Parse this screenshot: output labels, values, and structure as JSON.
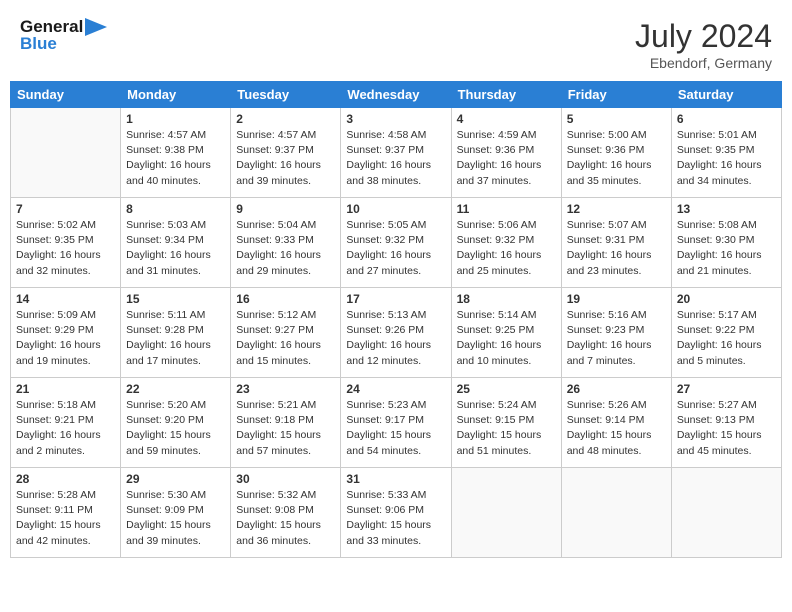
{
  "header": {
    "logo_line1": "General",
    "logo_line2": "Blue",
    "month_year": "July 2024",
    "location": "Ebendorf, Germany"
  },
  "days_of_week": [
    "Sunday",
    "Monday",
    "Tuesday",
    "Wednesday",
    "Thursday",
    "Friday",
    "Saturday"
  ],
  "weeks": [
    [
      {
        "day": "",
        "info": ""
      },
      {
        "day": "1",
        "info": "Sunrise: 4:57 AM\nSunset: 9:38 PM\nDaylight: 16 hours\nand 40 minutes."
      },
      {
        "day": "2",
        "info": "Sunrise: 4:57 AM\nSunset: 9:37 PM\nDaylight: 16 hours\nand 39 minutes."
      },
      {
        "day": "3",
        "info": "Sunrise: 4:58 AM\nSunset: 9:37 PM\nDaylight: 16 hours\nand 38 minutes."
      },
      {
        "day": "4",
        "info": "Sunrise: 4:59 AM\nSunset: 9:36 PM\nDaylight: 16 hours\nand 37 minutes."
      },
      {
        "day": "5",
        "info": "Sunrise: 5:00 AM\nSunset: 9:36 PM\nDaylight: 16 hours\nand 35 minutes."
      },
      {
        "day": "6",
        "info": "Sunrise: 5:01 AM\nSunset: 9:35 PM\nDaylight: 16 hours\nand 34 minutes."
      }
    ],
    [
      {
        "day": "7",
        "info": "Sunrise: 5:02 AM\nSunset: 9:35 PM\nDaylight: 16 hours\nand 32 minutes."
      },
      {
        "day": "8",
        "info": "Sunrise: 5:03 AM\nSunset: 9:34 PM\nDaylight: 16 hours\nand 31 minutes."
      },
      {
        "day": "9",
        "info": "Sunrise: 5:04 AM\nSunset: 9:33 PM\nDaylight: 16 hours\nand 29 minutes."
      },
      {
        "day": "10",
        "info": "Sunrise: 5:05 AM\nSunset: 9:32 PM\nDaylight: 16 hours\nand 27 minutes."
      },
      {
        "day": "11",
        "info": "Sunrise: 5:06 AM\nSunset: 9:32 PM\nDaylight: 16 hours\nand 25 minutes."
      },
      {
        "day": "12",
        "info": "Sunrise: 5:07 AM\nSunset: 9:31 PM\nDaylight: 16 hours\nand 23 minutes."
      },
      {
        "day": "13",
        "info": "Sunrise: 5:08 AM\nSunset: 9:30 PM\nDaylight: 16 hours\nand 21 minutes."
      }
    ],
    [
      {
        "day": "14",
        "info": "Sunrise: 5:09 AM\nSunset: 9:29 PM\nDaylight: 16 hours\nand 19 minutes."
      },
      {
        "day": "15",
        "info": "Sunrise: 5:11 AM\nSunset: 9:28 PM\nDaylight: 16 hours\nand 17 minutes."
      },
      {
        "day": "16",
        "info": "Sunrise: 5:12 AM\nSunset: 9:27 PM\nDaylight: 16 hours\nand 15 minutes."
      },
      {
        "day": "17",
        "info": "Sunrise: 5:13 AM\nSunset: 9:26 PM\nDaylight: 16 hours\nand 12 minutes."
      },
      {
        "day": "18",
        "info": "Sunrise: 5:14 AM\nSunset: 9:25 PM\nDaylight: 16 hours\nand 10 minutes."
      },
      {
        "day": "19",
        "info": "Sunrise: 5:16 AM\nSunset: 9:23 PM\nDaylight: 16 hours\nand 7 minutes."
      },
      {
        "day": "20",
        "info": "Sunrise: 5:17 AM\nSunset: 9:22 PM\nDaylight: 16 hours\nand 5 minutes."
      }
    ],
    [
      {
        "day": "21",
        "info": "Sunrise: 5:18 AM\nSunset: 9:21 PM\nDaylight: 16 hours\nand 2 minutes."
      },
      {
        "day": "22",
        "info": "Sunrise: 5:20 AM\nSunset: 9:20 PM\nDaylight: 15 hours\nand 59 minutes."
      },
      {
        "day": "23",
        "info": "Sunrise: 5:21 AM\nSunset: 9:18 PM\nDaylight: 15 hours\nand 57 minutes."
      },
      {
        "day": "24",
        "info": "Sunrise: 5:23 AM\nSunset: 9:17 PM\nDaylight: 15 hours\nand 54 minutes."
      },
      {
        "day": "25",
        "info": "Sunrise: 5:24 AM\nSunset: 9:15 PM\nDaylight: 15 hours\nand 51 minutes."
      },
      {
        "day": "26",
        "info": "Sunrise: 5:26 AM\nSunset: 9:14 PM\nDaylight: 15 hours\nand 48 minutes."
      },
      {
        "day": "27",
        "info": "Sunrise: 5:27 AM\nSunset: 9:13 PM\nDaylight: 15 hours\nand 45 minutes."
      }
    ],
    [
      {
        "day": "28",
        "info": "Sunrise: 5:28 AM\nSunset: 9:11 PM\nDaylight: 15 hours\nand 42 minutes."
      },
      {
        "day": "29",
        "info": "Sunrise: 5:30 AM\nSunset: 9:09 PM\nDaylight: 15 hours\nand 39 minutes."
      },
      {
        "day": "30",
        "info": "Sunrise: 5:32 AM\nSunset: 9:08 PM\nDaylight: 15 hours\nand 36 minutes."
      },
      {
        "day": "31",
        "info": "Sunrise: 5:33 AM\nSunset: 9:06 PM\nDaylight: 15 hours\nand 33 minutes."
      },
      {
        "day": "",
        "info": ""
      },
      {
        "day": "",
        "info": ""
      },
      {
        "day": "",
        "info": ""
      }
    ]
  ]
}
